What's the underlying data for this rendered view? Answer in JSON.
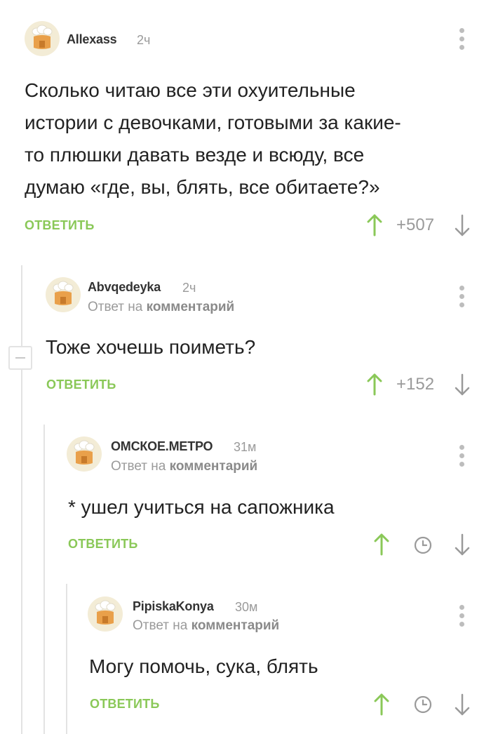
{
  "comments": [
    {
      "author": "Allexass",
      "time": "2ч",
      "reply_prefix": "",
      "reply_target": "",
      "lines": [
        "Сколько читаю все эти охуительные",
        "истории с девочками, готовыми за какие-",
        "то плюшки давать везде и всюду, все",
        "думаю «где, вы, блять, все обитаете?»"
      ],
      "reply_label": "ответить",
      "rating": "+507",
      "up_icon": "arrow-up-icon",
      "down_icon": "arrow-down-icon",
      "menu_icon": "more-vertical-icon"
    },
    {
      "author": "Abvqedeyka",
      "time": "2ч",
      "reply_prefix": "Ответ на",
      "reply_target": "комментарий",
      "lines": [
        "Тоже хочешь поиметь?"
      ],
      "reply_label": "ответить",
      "rating": "+152"
    },
    {
      "author": "ОМСКОЕ.МЕТРО",
      "time": "31м",
      "reply_prefix": "Ответ на",
      "reply_target": "комментарий",
      "lines": [
        "* ушел учиться на сапожника"
      ],
      "reply_label": "ответить",
      "rating_icon": "clock-icon"
    },
    {
      "author": "PipiskaKonya",
      "time": "30м",
      "reply_prefix": "Ответ на",
      "reply_target": "комментарий",
      "lines": [
        "Могу помочь, сука, блять"
      ],
      "reply_label": "ответить",
      "rating_icon": "clock-icon"
    }
  ],
  "colors": {
    "accent_green": "#8ac858",
    "muted_gray": "#9a9a9a",
    "thread_line": "#e3e3e3"
  }
}
